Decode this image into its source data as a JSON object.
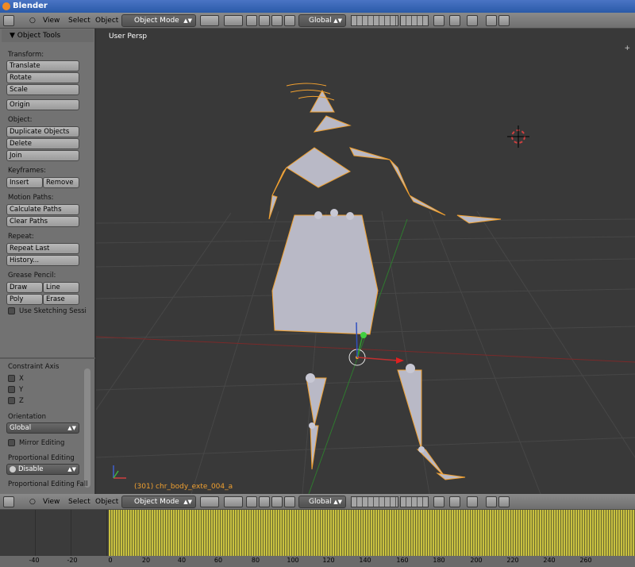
{
  "window": {
    "title": "Blender"
  },
  "view3d_header": {
    "menus": [
      "View",
      "Select",
      "Object"
    ],
    "mode": "Object Mode",
    "orientation": "Global"
  },
  "toolshelf": {
    "title": "Object Tools",
    "transform": {
      "label": "Transform:",
      "translate": "Translate",
      "rotate": "Rotate",
      "scale": "Scale",
      "origin": "Origin"
    },
    "object": {
      "label": "Object:",
      "duplicate": "Duplicate Objects",
      "delete": "Delete",
      "join": "Join"
    },
    "keyframes": {
      "label": "Keyframes:",
      "insert": "Insert",
      "remove": "Remove"
    },
    "motion_paths": {
      "label": "Motion Paths:",
      "calculate": "Calculate Paths",
      "clear": "Clear Paths"
    },
    "repeat": {
      "label": "Repeat:",
      "repeat_last": "Repeat Last",
      "history": "History..."
    },
    "grease_pencil": {
      "label": "Grease Pencil:",
      "draw": "Draw",
      "line": "Line",
      "poly": "Poly",
      "erase": "Erase",
      "sketching": "Use Sketching Sessi"
    }
  },
  "operator_panel": {
    "constraint_axis": "Constraint Axis",
    "x": "X",
    "y": "Y",
    "z": "Z",
    "orientation_label": "Orientation",
    "orientation_value": "Global",
    "mirror_editing": "Mirror Editing",
    "proportional_label": "Proportional Editing",
    "proportional_value": "Disable",
    "proportional_falloff": "Proportional Editing Fall"
  },
  "viewport": {
    "view_label": "User Persp",
    "object_info": "(301) chr_body_exte_004_a"
  },
  "timeline": {
    "ticks": [
      "-40",
      "-20",
      "0",
      "20",
      "40",
      "60",
      "80",
      "100",
      "120",
      "140",
      "160",
      "180",
      "200",
      "220",
      "240",
      "260"
    ]
  },
  "colors": {
    "selection": "#f0a030",
    "bone": "#b8b8c8",
    "grid": "#4a4a4a",
    "x_axis": "#9a2a2a",
    "y_axis": "#3a8a3a",
    "keyframe_yellow": "#c8c040"
  }
}
